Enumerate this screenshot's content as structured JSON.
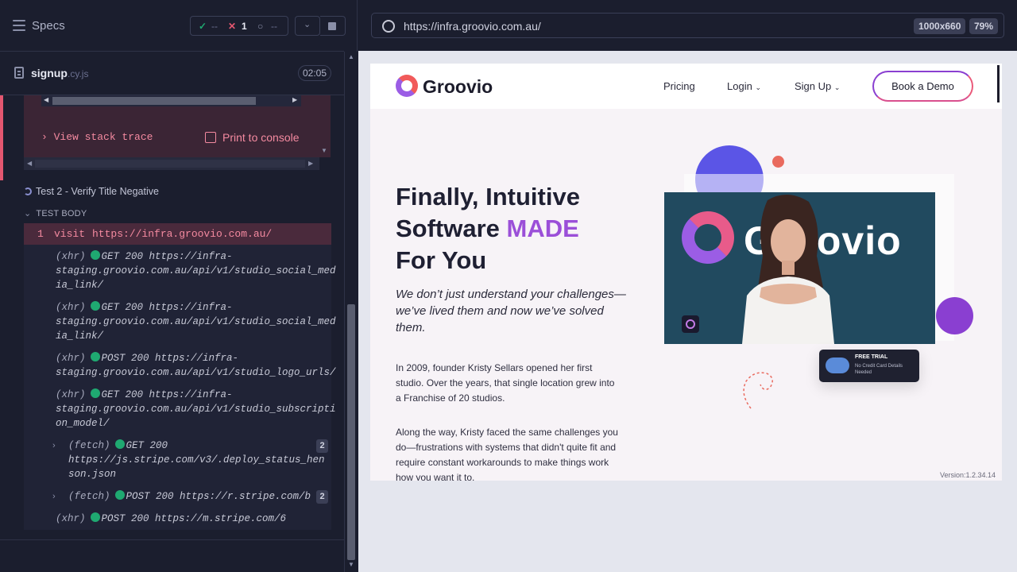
{
  "runner": {
    "specs_label": "Specs",
    "stats": {
      "passed": "--",
      "failed": "1",
      "pending": "--"
    },
    "spec": {
      "name": "signup",
      "ext": ".cy.js",
      "time": "02:05"
    },
    "error": {
      "stack_label": "View stack trace",
      "print_label": "Print to console"
    },
    "test_title": "Test 2 - Verify Title Negative",
    "body_label": "TEST BODY",
    "command": {
      "index": "1",
      "name": "visit",
      "arg": "https://infra.groovio.com.au/"
    },
    "logs": [
      {
        "type": "(xhr)",
        "lines": [
          "GET 200 https://infra-",
          "staging.groovio.com.au/api/v1/studio_social_med",
          "ia_link/"
        ]
      },
      {
        "type": "(xhr)",
        "lines": [
          "GET 200 https://infra-",
          "staging.groovio.com.au/api/v1/studio_social_med",
          "ia_link/"
        ]
      },
      {
        "type": "(xhr)",
        "lines": [
          "POST 200 https://infra-",
          "staging.groovio.com.au/api/v1/studio_logo_urls/"
        ]
      },
      {
        "type": "(xhr)",
        "lines": [
          "GET 200 https://infra-",
          "staging.groovio.com.au/api/v1/studio_subscripti",
          "on_model/"
        ]
      },
      {
        "type": "(fetch)",
        "lines": [
          "GET 200",
          "https://js.stripe.com/v3/.deploy_status_hen",
          "son.json"
        ],
        "count": "2"
      },
      {
        "type": "(fetch)",
        "lines": [
          "POST 200 https://r.stripe.com/b"
        ],
        "count": "2"
      },
      {
        "type": "(xhr)",
        "lines": [
          "POST 200 https://m.stripe.com/6"
        ]
      }
    ]
  },
  "browser": {
    "url": "https://infra.groovio.com.au/",
    "viewport": "1000x660",
    "zoom": "79%"
  },
  "site": {
    "logo": "Groovio",
    "nav": {
      "pricing": "Pricing",
      "login": "Login",
      "signup": "Sign Up",
      "demo": "Book a Demo"
    },
    "headline_1": "Finally, Intuitive",
    "headline_2a": "Software ",
    "headline_2b": "MADE",
    "headline_3": "For You",
    "subheadline": "We don’t just understand your challenges— we’ve lived them and now we’ve solved them.",
    "para1": "In 2009, founder Kristy Sellars opened her first studio. Over the years, that single location grew into a Franchise of 20 studios.",
    "para2": "Along the way, Kristy faced the same challenges you do—frustrations with systems that didn't quite fit and require constant workarounds to make things work how you want it to.",
    "video_text": "Groovio",
    "trial_title": "FREE TRIAL",
    "trial_sub": "No Credit Card Details Needed",
    "version": "Version:1.2.34.14"
  },
  "colors": {
    "accent": "#9b4fd8",
    "success": "#1fa971",
    "error": "#e45770"
  }
}
